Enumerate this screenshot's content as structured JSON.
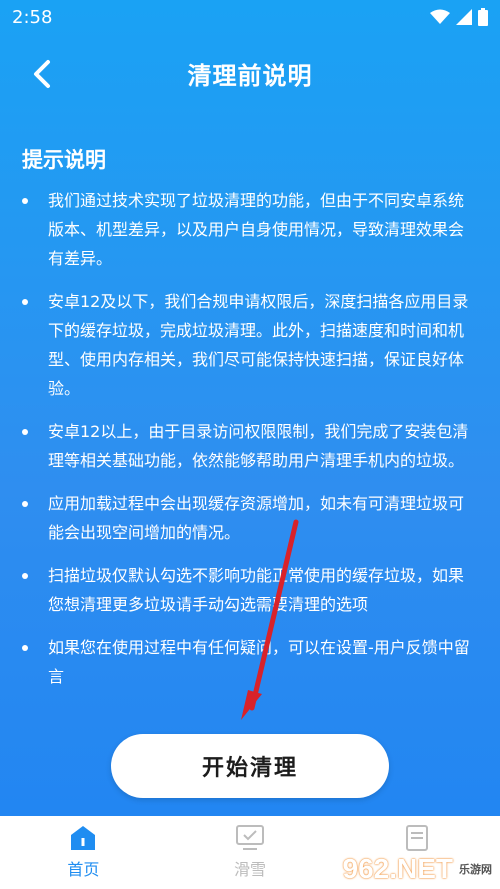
{
  "status_bar": {
    "time": "2:58",
    "icons": [
      "wifi-icon",
      "signal-icon",
      "battery-icon"
    ]
  },
  "header": {
    "back_icon": "chevron-left-icon",
    "title": "清理前说明"
  },
  "section": {
    "title": "提示说明"
  },
  "tips": [
    "我们通过技术实现了垃圾清理的功能，但由于不同安卓系统版本、机型差异，以及用户自身使用情况，导致清理效果会有差异。",
    "安卓12及以下，我们合规申请权限后，深度扫描各应用目录下的缓存垃圾，完成垃圾清理。此外，扫描速度和时间和机型、使用内存相关，我们尽可能保持快速扫描，保证良好体验。",
    "安卓12以上，由于目录访问权限限制，我们完成了安装包清理等相关基础功能，依然能够帮助用户清理手机内的垃圾。",
    "应用加载过程中会出现缓存资源增加，如未有可清理垃圾可能会出现空间增加的情况。",
    "扫描垃圾仅默认勾选不影响功能正常使用的缓存垃圾，如果您想清理更多垃圾请手动勾选需要清理的选项",
    "如果您在使用过程中有任何疑问，可以在设置-用户反馈中留言"
  ],
  "start_button": {
    "label": "开始清理"
  },
  "bottom_nav": [
    {
      "label": "首页",
      "icon": "home-icon",
      "active": true
    },
    {
      "label": "滑雪",
      "icon": "checkbox-screen-icon",
      "active": false
    },
    {
      "label": "",
      "icon": "document-icon",
      "active": false
    }
  ],
  "watermark": {
    "logo": "962.NET",
    "sub": "乐游网"
  },
  "colors": {
    "background_top": "#1aa2f4",
    "background_bottom": "#1f84f2",
    "accent": "#1f8df1",
    "annotation_arrow": "#d8222a"
  }
}
